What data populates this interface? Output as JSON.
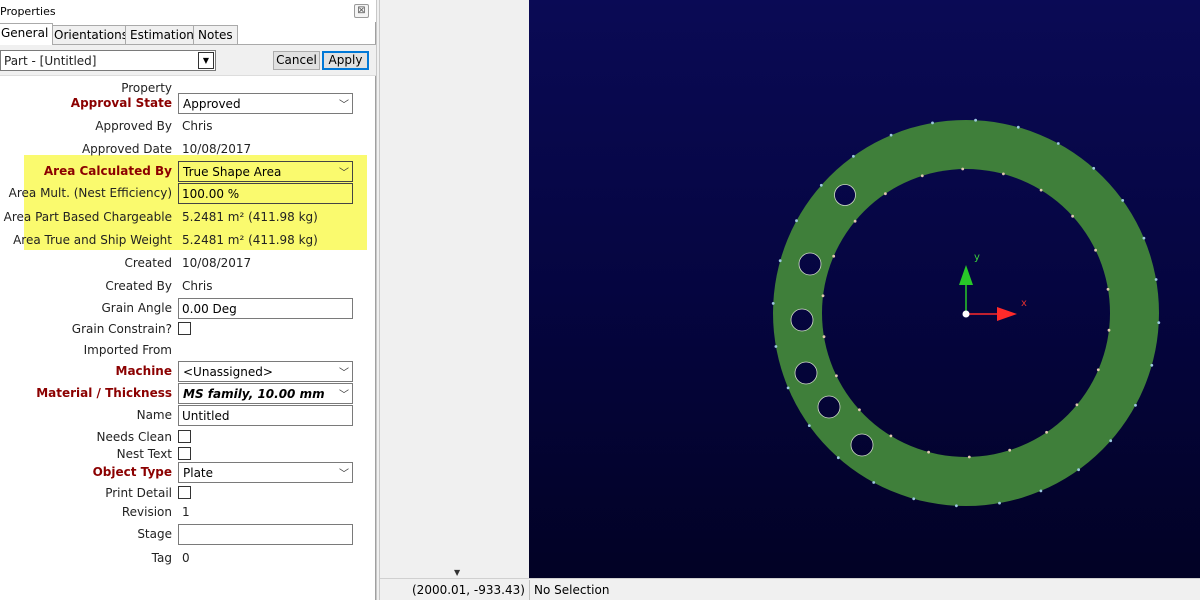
{
  "panel": {
    "title": "Properties",
    "close_glyph": "⊠",
    "tabs": [
      "General",
      "Orientations",
      "Estimation",
      "Notes"
    ],
    "active_tab": "General",
    "part_selector": "Part - [Untitled]",
    "cancel_label": "Cancel",
    "apply_label": "Apply",
    "header_label": "Property",
    "props": {
      "approval_state": {
        "label": "Approval State",
        "value": "Approved"
      },
      "approved_by": {
        "label": "Approved By",
        "value": "Chris"
      },
      "approved_date": {
        "label": "Approved Date",
        "value": "10/08/2017"
      },
      "area_calc": {
        "label": "Area Calculated By",
        "value": "True Shape Area"
      },
      "area_mult": {
        "label": "Area Mult. (Nest Efficiency)",
        "value": "100.00 %"
      },
      "area_part": {
        "label": "Area Part Based Chargeable",
        "value": "5.2481 m² (411.98 kg)"
      },
      "area_true": {
        "label": "Area True and Ship Weight",
        "value": "5.2481 m² (411.98 kg)"
      },
      "created": {
        "label": "Created",
        "value": "10/08/2017"
      },
      "created_by": {
        "label": "Created By",
        "value": "Chris"
      },
      "grain_angle": {
        "label": "Grain Angle",
        "value": "0.00 Deg"
      },
      "grain_constrain": {
        "label": "Grain Constrain?",
        "checked": false
      },
      "imported_from": {
        "label": "Imported From",
        "value": ""
      },
      "machine": {
        "label": "Machine",
        "value": "<Unassigned>"
      },
      "material": {
        "label": "Material / Thickness",
        "value": "MS family, 10.00 mm"
      },
      "name": {
        "label": "Name",
        "value": "Untitled"
      },
      "needs_clean": {
        "label": "Needs Clean",
        "checked": false
      },
      "nest_text": {
        "label": "Nest Text",
        "checked": false
      },
      "object_type": {
        "label": "Object Type",
        "value": "Plate"
      },
      "print_detail": {
        "label": "Print Detail",
        "checked": false
      },
      "revision": {
        "label": "Revision",
        "value": "1"
      },
      "stage": {
        "label": "Stage",
        "value": ""
      },
      "tag": {
        "label": "Tag",
        "value": "0"
      }
    }
  },
  "viewport": {
    "axis_x_label": "x",
    "axis_y_label": "y",
    "part_color": "#3f7f3a",
    "hole_count": 6
  },
  "status": {
    "coords": "(2000.01, -933.43)",
    "selection": "No Selection"
  },
  "colors": {
    "highlight": "#fafa6e",
    "label_emphasis": "#8b0000",
    "canvas_bg": "#050540"
  }
}
